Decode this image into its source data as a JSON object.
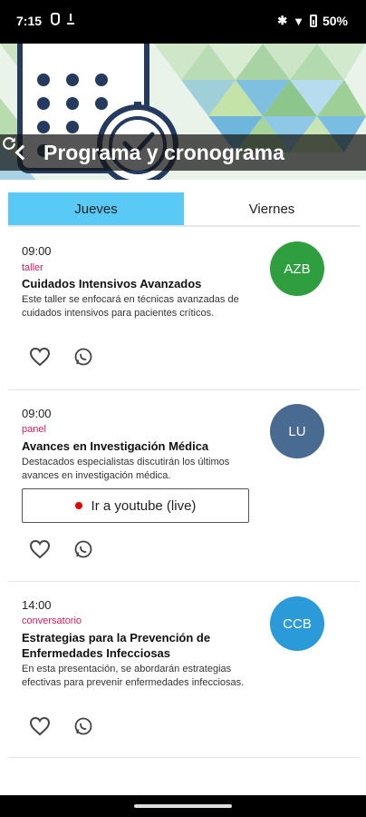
{
  "status_bar": {
    "time": "7:15",
    "battery": "50%"
  },
  "header": {
    "title": "Programa y cronograma"
  },
  "tabs": [
    {
      "label": "Jueves",
      "active": true
    },
    {
      "label": "Viernes",
      "active": false
    }
  ],
  "events": [
    {
      "time": "09:00",
      "type": "taller",
      "title": "Cuidados Intensivos Avanzados",
      "description": "Este taller se enfocará en técnicas avanzadas de cuidados intensivos para pacientes críticos.",
      "avatar_initials": "AZB",
      "avatar_color": "#2e9e3e"
    },
    {
      "time": "09:00",
      "type": "panel",
      "title": "Avances en Investigación Médica",
      "description": "Destacados especialistas discutirán los últimos avances en investigación médica.",
      "avatar_initials": "LU",
      "avatar_color": "#4a6b91",
      "live_button": "Ir a youtube (live)"
    },
    {
      "time": "14:00",
      "type": "conversatorio",
      "title": "Estrategias para la Prevención de Enfermedades Infecciosas",
      "description": "En esta presentación, se abordarán estrategias efectivas para prevenir enfermedades infecciosas.",
      "avatar_initials": "CCB",
      "avatar_color": "#2a9ad8"
    }
  ],
  "colors": {
    "tab_active": "#59c9f6",
    "type_label": "#d81b60",
    "live_dot": "#e60000"
  }
}
